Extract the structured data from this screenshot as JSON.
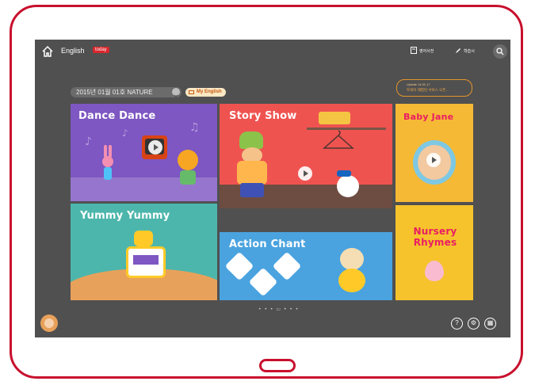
{
  "header": {
    "app_title": "English",
    "today_badge": "today",
    "dictionary_label": "영어사전",
    "study_label": "학습시"
  },
  "breadcrumb": {
    "text": "2015년 01월 01호  NATURE",
    "my_english": "My English"
  },
  "update_notice": {
    "line1": "Update 14.01.17",
    "line2": "투데이 재험된 서비스 오픈..."
  },
  "tiles": [
    {
      "title": "Dance Dance",
      "color": "#7e57c2"
    },
    {
      "title": "Story Show",
      "color": "#ef5350"
    },
    {
      "title": "Baby Jane",
      "color": "#f5b935"
    },
    {
      "title": "Yummy Yummy",
      "color": "#4db6ac"
    },
    {
      "title": "Action Chant",
      "color": "#4aa3df"
    },
    {
      "title": "Nursery Rhymes",
      "color": "#f6c32c"
    }
  ],
  "pager": "• • • ▭ • • •",
  "bottom_buttons": [
    "?",
    "⚙",
    "▦"
  ],
  "colors": {
    "frame": "#c8102e",
    "screen": "#505050",
    "accent": "#e39429"
  }
}
